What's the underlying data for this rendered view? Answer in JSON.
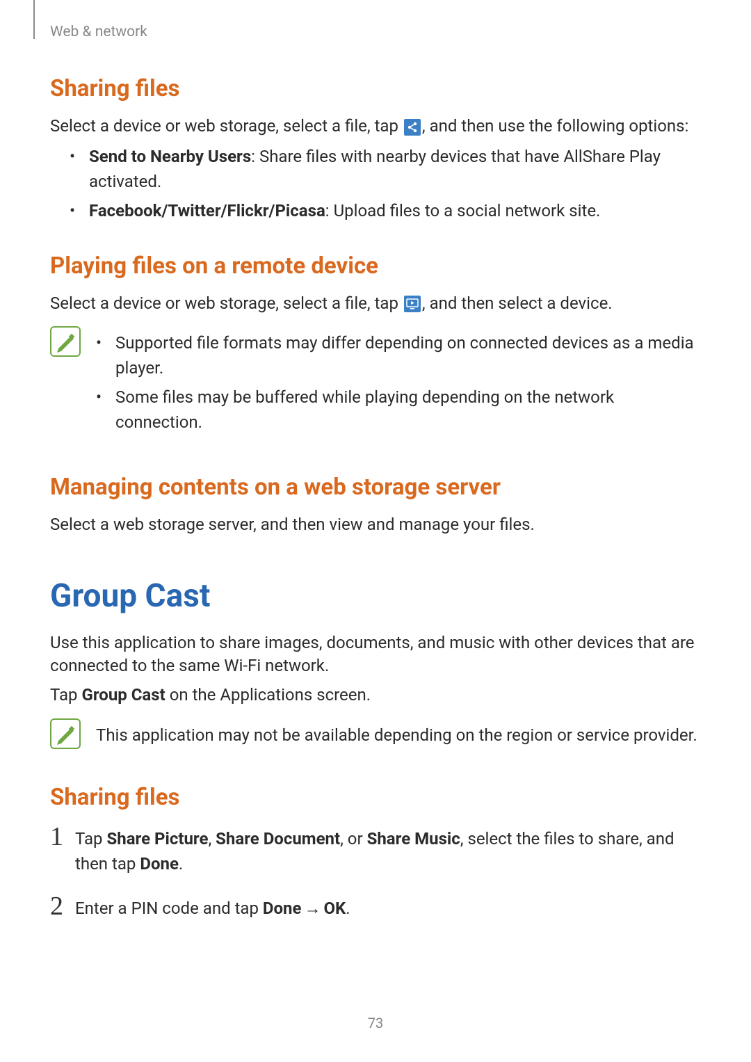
{
  "header": "Web & network",
  "section1": {
    "heading": "Sharing files",
    "intro_before": "Select a device or web storage, select a file, tap ",
    "intro_after": ", and then use the following options:",
    "bullets": [
      {
        "bold": "Send to Nearby Users",
        "rest": ": Share files with nearby devices that have AllShare Play activated."
      },
      {
        "bold": "Facebook/Twitter/Flickr/Picasa",
        "rest": ": Upload files to a social network site."
      }
    ]
  },
  "section2": {
    "heading": "Playing files on a remote device",
    "intro_before": "Select a device or web storage, select a file, tap ",
    "intro_after": ", and then select a device.",
    "note_bullets": [
      "Supported file formats may differ depending on connected devices as a media player.",
      "Some files may be buffered while playing depending on the network connection."
    ]
  },
  "section3": {
    "heading": "Managing contents on a web storage server",
    "body": "Select a web storage server, and then view and manage your files."
  },
  "main": {
    "heading": "Group Cast",
    "body": "Use this application to share images, documents, and music with other devices that are connected to the same Wi-Fi network.",
    "tap_before": "Tap ",
    "tap_bold": "Group Cast",
    "tap_after": " on the Applications screen.",
    "note": "This application may not be available depending on the region or service provider."
  },
  "section4": {
    "heading": "Sharing files",
    "steps": [
      {
        "num": "1",
        "parts": [
          "Tap ",
          "Share Picture",
          ", ",
          "Share Document",
          ", or ",
          "Share Music",
          ", select the files to share, and then tap ",
          "Done",
          "."
        ]
      },
      {
        "num": "2",
        "parts": [
          "Enter a PIN code and tap ",
          "Done",
          " → ",
          "OK",
          "."
        ]
      }
    ]
  },
  "page_number": "73"
}
